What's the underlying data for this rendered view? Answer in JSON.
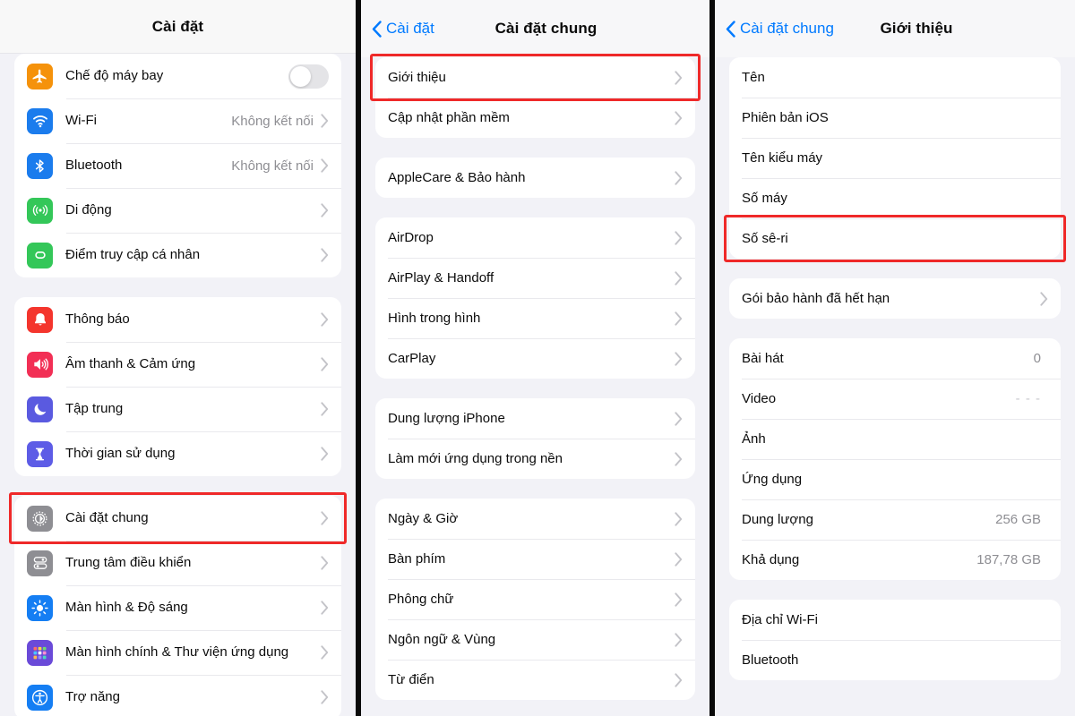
{
  "panels": {
    "settings": {
      "header": {
        "title": "Cài đặt"
      },
      "groups": [
        {
          "rows": [
            {
              "icon": "airplane-icon",
              "label": "Chế độ máy bay",
              "control": "toggle",
              "toggle_on": false,
              "icon_color": "#f5920b"
            },
            {
              "icon": "wifi-icon",
              "label": "Wi-Fi",
              "value": "Không kết nối",
              "chevron": true,
              "icon_color": "#1b7ced"
            },
            {
              "icon": "bluetooth-icon",
              "label": "Bluetooth",
              "value": "Không kết nối",
              "chevron": true,
              "icon_color": "#1b7ced"
            },
            {
              "icon": "cellular-icon",
              "label": "Di động",
              "chevron": true,
              "icon_color": "#34c759"
            },
            {
              "icon": "hotspot-icon",
              "label": "Điểm truy cập cá nhân",
              "chevron": true,
              "icon_color": "#34c759"
            }
          ]
        },
        {
          "rows": [
            {
              "icon": "notification-bell-icon",
              "label": "Thông báo",
              "chevron": true,
              "icon_color": "#f4352d"
            },
            {
              "icon": "sound-icon",
              "label": "Âm thanh & Cảm ứng",
              "chevron": true,
              "icon_color": "#f22f55"
            },
            {
              "icon": "focus-moon-icon",
              "label": "Tập trung",
              "chevron": true,
              "icon_color": "#5a5ae0"
            },
            {
              "icon": "hourglass-icon",
              "label": "Thời gian sử dụng",
              "chevron": true,
              "icon_color": "#5d5ce6"
            }
          ]
        },
        {
          "rows": [
            {
              "icon": "gear-icon",
              "label": "Cài đặt chung",
              "chevron": true,
              "icon_color": "#8e8e93",
              "highlighted": true
            },
            {
              "icon": "control-center-icon",
              "label": "Trung tâm điều khiển",
              "chevron": true,
              "icon_color": "#8e8e93"
            },
            {
              "icon": "brightness-icon",
              "label": "Màn hình & Độ sáng",
              "chevron": true,
              "icon_color": "#157ef3"
            },
            {
              "icon": "home-screen-icon",
              "label": "Màn hình chính & Thư viện ứng dụng",
              "chevron": true,
              "icon_color": "#6a4ad8"
            },
            {
              "icon": "accessibility-icon",
              "label": "Trợ năng",
              "chevron": true,
              "icon_color": "#157ef3"
            }
          ]
        }
      ]
    },
    "general": {
      "header": {
        "back_label": "Cài đặt",
        "title": "Cài đặt chung"
      },
      "groups": [
        {
          "rows": [
            {
              "label": "Giới thiệu",
              "chevron": true,
              "highlighted": true
            },
            {
              "label": "Cập nhật phần mềm",
              "chevron": true
            }
          ]
        },
        {
          "rows": [
            {
              "label": "AppleCare & Bảo hành",
              "chevron": true
            }
          ]
        },
        {
          "rows": [
            {
              "label": "AirDrop",
              "chevron": true
            },
            {
              "label": "AirPlay & Handoff",
              "chevron": true
            },
            {
              "label": "Hình trong hình",
              "chevron": true
            },
            {
              "label": "CarPlay",
              "chevron": true
            }
          ]
        },
        {
          "rows": [
            {
              "label": "Dung lượng iPhone",
              "chevron": true
            },
            {
              "label": "Làm mới ứng dụng trong nền",
              "chevron": true
            }
          ]
        },
        {
          "rows": [
            {
              "label": "Ngày & Giờ",
              "chevron": true
            },
            {
              "label": "Bàn phím",
              "chevron": true
            },
            {
              "label": "Phông chữ",
              "chevron": true
            },
            {
              "label": "Ngôn ngữ & Vùng",
              "chevron": true
            },
            {
              "label": "Từ điển",
              "chevron": true
            }
          ]
        }
      ]
    },
    "about": {
      "header": {
        "back_label": "Cài đặt chung",
        "title": "Giới thiệu"
      },
      "groups": [
        {
          "rows": [
            {
              "label": "Tên"
            },
            {
              "label": "Phiên bản iOS"
            },
            {
              "label": "Tên kiểu máy"
            },
            {
              "label": "Số máy"
            },
            {
              "label": "Số sê-ri",
              "highlighted": true
            }
          ]
        },
        {
          "rows": [
            {
              "label": "Gói bảo hành đã hết hạn",
              "chevron": true
            }
          ]
        },
        {
          "rows": [
            {
              "label": "Bài hát",
              "value": "0"
            },
            {
              "label": "Video",
              "value": "- - -",
              "dashes": true
            },
            {
              "label": "Ảnh"
            },
            {
              "label": "Ứng dụng"
            },
            {
              "label": "Dung lượng",
              "value": "256 GB"
            },
            {
              "label": "Khả dụng",
              "value": "187,78 GB"
            }
          ]
        },
        {
          "rows": [
            {
              "label": "Địa chỉ Wi-Fi"
            },
            {
              "label": "Bluetooth"
            }
          ]
        }
      ]
    }
  },
  "colors": {
    "accent_blue": "#007aff",
    "highlight_red": "#ef2929",
    "page_bg": "#f2f2f7",
    "card_bg": "#ffffff",
    "secondary_text": "#8e8e93"
  }
}
